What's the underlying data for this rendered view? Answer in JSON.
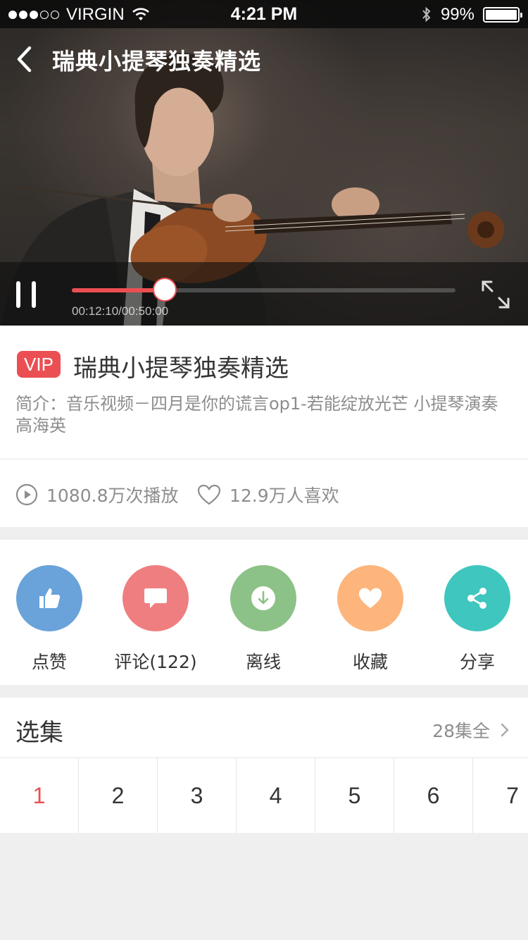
{
  "status_bar": {
    "carrier": "VIRGIN",
    "time": "4:21 PM",
    "battery": "99%",
    "battery_level": 0.99
  },
  "header": {
    "title": "瑞典小提琴独奏精选"
  },
  "player": {
    "elapsed": "00:12:10",
    "duration": "00:50:00",
    "time_readout": "00:12:10/00:50:00",
    "progress": 0.243,
    "accent": "#eb4f53"
  },
  "info": {
    "vip_badge": "VIP",
    "title": "瑞典小提琴独奏精选",
    "description": "简介：音乐视频－四月是你的谎言op1-若能绽放光芒 小提琴演奏高海英"
  },
  "stats": {
    "plays": "1080.8万次播放",
    "likes": "12.9万人喜欢"
  },
  "actions": [
    {
      "label": "点赞",
      "icon": "thumbs-up-icon",
      "color": "#6aa2da"
    },
    {
      "label": "评论(122)",
      "icon": "comment-icon",
      "color": "#ef7e80"
    },
    {
      "label": "离线",
      "icon": "download-icon",
      "color": "#8cc287"
    },
    {
      "label": "收藏",
      "icon": "heart-icon",
      "color": "#fdb57c"
    },
    {
      "label": "分享",
      "icon": "share-icon",
      "color": "#3fc6be"
    }
  ],
  "episodes": {
    "title": "选集",
    "total": "28集全",
    "items": [
      "1",
      "2",
      "3",
      "4",
      "5",
      "6",
      "7"
    ],
    "active_index": 0,
    "active_color": "#eb4f53",
    "text_color": "#343434",
    "muted_color": "#8d8d8d"
  }
}
